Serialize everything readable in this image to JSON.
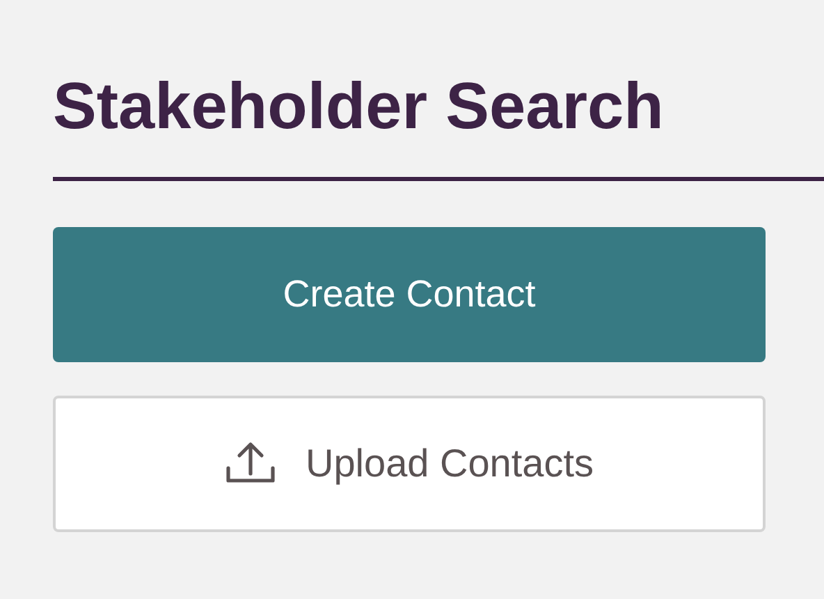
{
  "title": "Stakeholder Search",
  "buttons": [
    {
      "kind": "primary",
      "label": "Create Contact"
    },
    {
      "kind": "upload",
      "label": "Upload Contacts"
    }
  ]
}
